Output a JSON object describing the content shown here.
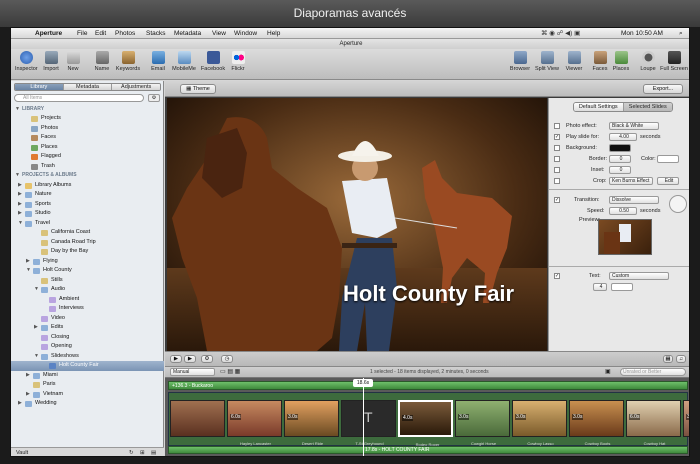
{
  "outer_title": "Diaporamas avancés",
  "menubar": {
    "apple": "",
    "app": "Aperture",
    "items": [
      "File",
      "Edit",
      "Photos",
      "Stacks",
      "Metadata",
      "View",
      "Window",
      "Help"
    ],
    "clock": "Mon 10:50 AM"
  },
  "window_title": "Aperture",
  "toolbar": {
    "left": [
      "Inspector",
      "Import",
      "New",
      "Name",
      "Keywords",
      "Email",
      "MobileMe",
      "Facebook",
      "Flickr"
    ],
    "right": [
      "Browser",
      "Split View",
      "Viewer",
      "Faces",
      "Places",
      "Loupe",
      "Full Screen"
    ]
  },
  "sidebar": {
    "tabs": [
      "Library",
      "Metadata",
      "Adjustments"
    ],
    "search_placeholder": "All Items",
    "library_header": "LIBRARY",
    "library_items": [
      "Projects",
      "Photos",
      "Faces",
      "Places",
      "Flagged",
      "Trash"
    ],
    "projects_header": "PROJECTS & ALBUMS",
    "tree": [
      "Library Albums",
      "Nature",
      "Sports",
      "Studio",
      "Travel",
      "California Coast",
      "Canada Road Trip",
      "Day by the Bay",
      "Flying",
      "Holt County",
      "Stills",
      "Audio",
      "Ambient",
      "Interviews",
      "Video",
      "Edits",
      "Closing",
      "Opening",
      "Slideshows",
      "Holt County Fair",
      "Miami",
      "Paris",
      "Vietnam",
      "Wedding"
    ],
    "footer": "Vault"
  },
  "content": {
    "theme_button": "Theme",
    "export_button": "Export...",
    "title_overlay": "Holt County Fair",
    "inspector": {
      "tabs": [
        "Default Settings",
        "Selected Slides"
      ],
      "photo_effect_label": "Photo effect:",
      "photo_effect_value": "Black & White",
      "play_slide_label": "Play slide for:",
      "play_slide_value": "4.00",
      "play_slide_unit": "seconds",
      "background_label": "Background:",
      "border_label": "Border:",
      "border_value": "0",
      "color_label": "Color:",
      "inset_label": "Inset:",
      "inset_value": "0",
      "crop_label": "Crop:",
      "crop_value": "Ken Burns Effect",
      "edit_button": "Edit",
      "transition_label": "Transition:",
      "transition_value": "Dissolve",
      "speed_label": "Speed:",
      "speed_value": "0.50",
      "speed_unit": "seconds",
      "preview_label": "Preview:",
      "text_label": "Text:",
      "text_value": "Custom",
      "text_size": "4"
    },
    "strip": {
      "mode": "Manual",
      "status": "1 selected - 18 items displayed, 2 minutes, 0 seconds",
      "filter": "Unrated or Better"
    },
    "timeline": {
      "audio_label": "+136.3 - Buckaroo",
      "playhead": "18.6s",
      "clips": [
        {
          "dur": "6.0s",
          "cap": "Hayley Lancaster"
        },
        {
          "dur": "3.0s",
          "cap": "Desert Ride"
        },
        {
          "dur": "",
          "cap": "T-St Greyhound"
        },
        {
          "dur": "4.0s",
          "cap": "Rodeo Roper"
        },
        {
          "dur": "3.0s",
          "cap": "Cowgirl Horse"
        },
        {
          "dur": "3.0s",
          "cap": "Cowboy Lasso"
        },
        {
          "dur": "3.0s",
          "cap": "Cowboy Boots"
        },
        {
          "dur": "6.0s",
          "cap": "Cowboy Hat"
        },
        {
          "dur": "3.0s",
          "cap": "Girl Smile"
        },
        {
          "dur": "6.0s",
          "cap": "Rider Group"
        }
      ],
      "bottom_label": "17.8s - HOLT COUNTY FAIR"
    }
  }
}
